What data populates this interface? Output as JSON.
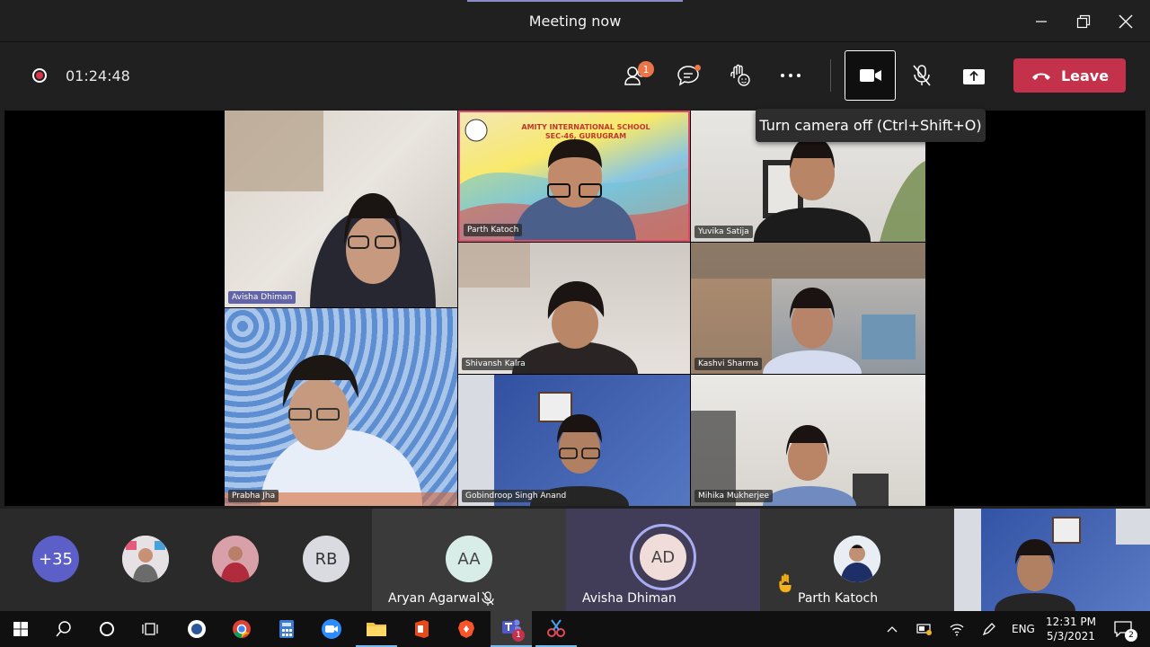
{
  "window": {
    "title": "Meeting now"
  },
  "toolbar": {
    "timer": "01:24:48",
    "participants_badge": "1",
    "leave_label": "Leave",
    "tooltip": "Turn camera off (Ctrl+Shift+O)"
  },
  "tiles": [
    {
      "name": "Avisha Dhiman"
    },
    {
      "name": "Parth Katoch",
      "banner1": "AMITY INTERNATIONAL SCHOOL",
      "banner2": "SEC-46, GURUGRAM"
    },
    {
      "name": "Yuvika Satija"
    },
    {
      "name": "Shivansh Kalra"
    },
    {
      "name": "Kashvi Sharma"
    },
    {
      "name": "Prabha Jha"
    },
    {
      "name": "Gobindroop Singh Anand"
    },
    {
      "name": "Mihika Mukherjee"
    }
  ],
  "strip": {
    "overflow": "+35",
    "rb_initials": "RB",
    "cards": [
      {
        "initials": "AA",
        "name": "Aryan Agarwal"
      },
      {
        "initials": "AD",
        "name": "Avisha Dhiman"
      },
      {
        "name": "Parth Katoch"
      }
    ]
  },
  "taskbar": {
    "lang": "ENG",
    "time": "12:31 PM",
    "date": "5/3/2021",
    "teams_badge": "1",
    "notif_count": "2"
  },
  "colors": {
    "accent": "#6264a7",
    "leave": "#c4314b",
    "badge": "#e97548"
  }
}
